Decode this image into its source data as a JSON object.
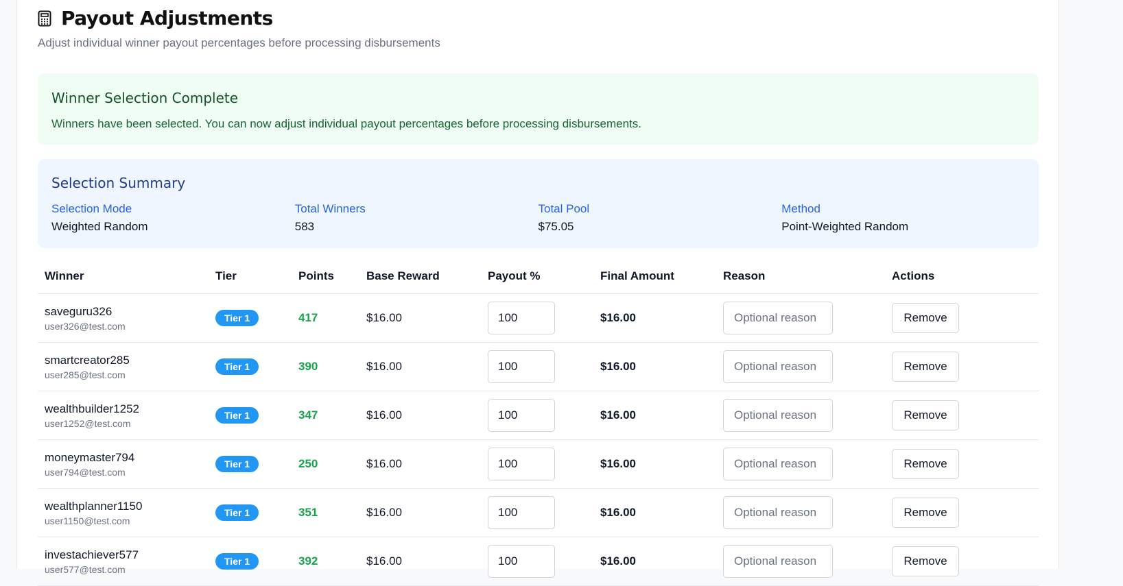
{
  "header": {
    "title": "Payout Adjustments",
    "subtitle": "Adjust individual winner payout percentages before processing disbursements"
  },
  "alert": {
    "title": "Winner Selection Complete",
    "text": "Winners have been selected. You can now adjust individual payout percentages before processing disbursements."
  },
  "summary": {
    "title": "Selection Summary",
    "items": [
      {
        "label": "Selection Mode",
        "value": "Weighted Random"
      },
      {
        "label": "Total Winners",
        "value": "583"
      },
      {
        "label": "Total Pool",
        "value": "$75.05"
      },
      {
        "label": "Method",
        "value": "Point-Weighted Random"
      }
    ]
  },
  "table": {
    "columns": [
      "Winner",
      "Tier",
      "Points",
      "Base Reward",
      "Payout %",
      "Final Amount",
      "Reason",
      "Actions"
    ],
    "reason_placeholder": "Optional reason",
    "remove_label": "Remove",
    "rows": [
      {
        "name": "saveguru326",
        "email": "user326@test.com",
        "tier": "Tier 1",
        "points": "417",
        "base": "$16.00",
        "payout": "100",
        "final": "$16.00"
      },
      {
        "name": "smartcreator285",
        "email": "user285@test.com",
        "tier": "Tier 1",
        "points": "390",
        "base": "$16.00",
        "payout": "100",
        "final": "$16.00"
      },
      {
        "name": "wealthbuilder1252",
        "email": "user1252@test.com",
        "tier": "Tier 1",
        "points": "347",
        "base": "$16.00",
        "payout": "100",
        "final": "$16.00"
      },
      {
        "name": "moneymaster794",
        "email": "user794@test.com",
        "tier": "Tier 1",
        "points": "250",
        "base": "$16.00",
        "payout": "100",
        "final": "$16.00"
      },
      {
        "name": "wealthplanner1150",
        "email": "user1150@test.com",
        "tier": "Tier 1",
        "points": "351",
        "base": "$16.00",
        "payout": "100",
        "final": "$16.00"
      },
      {
        "name": "investachiever577",
        "email": "user577@test.com",
        "tier": "Tier 1",
        "points": "392",
        "base": "$16.00",
        "payout": "100",
        "final": "$16.00"
      }
    ]
  },
  "colors": {
    "tier_badge": "#2196f3",
    "points": "#16a34a",
    "success_bg": "#f0fdf4",
    "summary_bg": "#eff6ff"
  }
}
